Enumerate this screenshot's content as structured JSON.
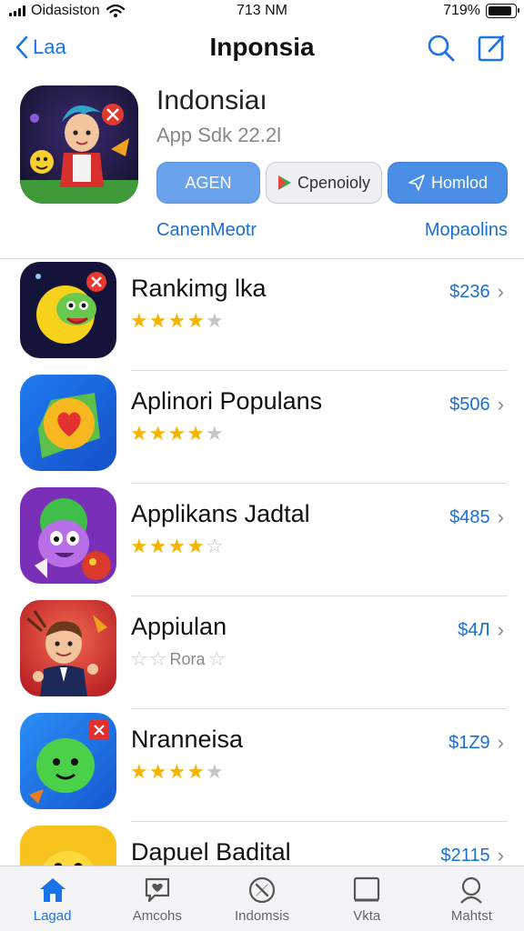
{
  "status_bar": {
    "carrier": "Oidasiston",
    "time": "713 NM",
    "battery": "719%",
    "battery_level": 0.9
  },
  "nav": {
    "back_label": "Laa",
    "title": "Inponsia",
    "icons": [
      "search-icon",
      "compose-icon"
    ]
  },
  "header_app": {
    "name": "Indonsiaı",
    "subtitle": "App Sdk 22.2l",
    "buttons": {
      "primary": "AGEN",
      "secondary": "Cpenoioly",
      "accent": "Homlod"
    },
    "links": {
      "left": "CanenMeotr",
      "right": "Mopaolins"
    }
  },
  "apps": [
    {
      "name": "Rankimg lka",
      "price": "$236",
      "stars": [
        1,
        1,
        1,
        1,
        0
      ],
      "rating_text": ""
    },
    {
      "name": "Aplinori Populans",
      "price": "$506",
      "stars": [
        1,
        1,
        1,
        1,
        0.5
      ],
      "rating_text": ""
    },
    {
      "name": "Applikans Jadtal",
      "price": "$485",
      "stars": [
        1,
        1,
        1,
        1,
        0.5
      ],
      "rating_text": ""
    },
    {
      "name": "Appiulan",
      "price": "$4Л",
      "stars": [
        0,
        0,
        0,
        0,
        0
      ],
      "rating_text": "Rora"
    },
    {
      "name": "Nranneisa",
      "price": "$1Z9",
      "stars": [
        1,
        1,
        1,
        1,
        0
      ],
      "rating_text": ""
    },
    {
      "name": "Dapuel Badital",
      "price": "$2115",
      "stars": [],
      "rating_text": ""
    }
  ],
  "tabs": [
    {
      "label": "Lagad",
      "icon": "home-icon",
      "active": true
    },
    {
      "label": "Amcohs",
      "icon": "heart-chat-icon",
      "active": false
    },
    {
      "label": "Indomsis",
      "icon": "compass-icon",
      "active": false
    },
    {
      "label": "Vkta",
      "icon": "square-icon",
      "active": false
    },
    {
      "label": "Mahtst",
      "icon": "search-icon",
      "active": false
    }
  ],
  "colors": {
    "accent": "#1a73e8",
    "star": "#f5b400",
    "primary_button": "#6aa3ec",
    "accent_button": "#4a8ee6"
  }
}
